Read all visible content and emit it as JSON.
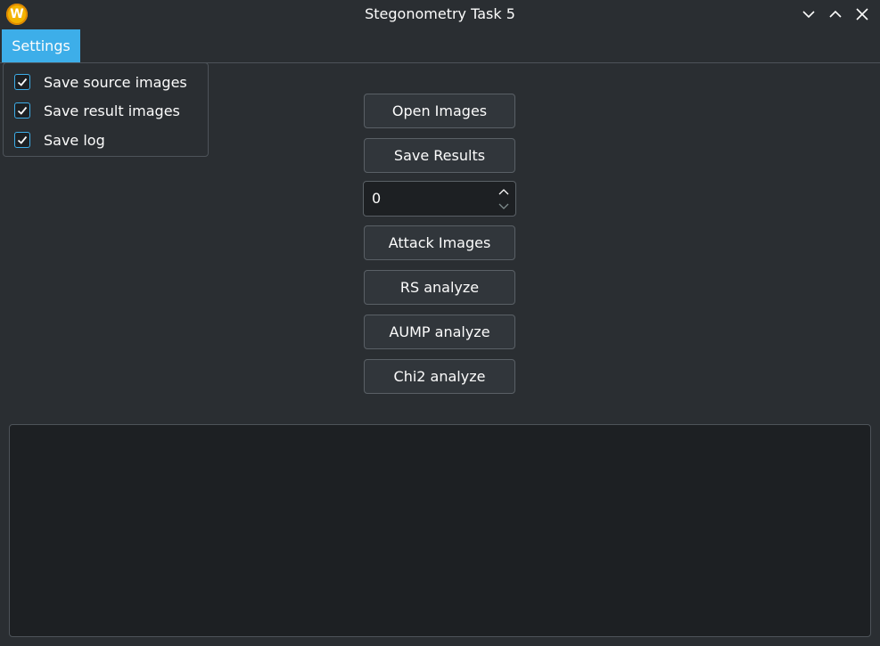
{
  "window": {
    "title": "Stegonometry Task 5",
    "logo_letter": "W"
  },
  "menubar": {
    "settings_label": "Settings"
  },
  "settings_menu": {
    "items": [
      {
        "label": "Save source images",
        "checked": true
      },
      {
        "label": "Save result images",
        "checked": true
      },
      {
        "label": "Save log",
        "checked": true
      }
    ]
  },
  "controls": {
    "open_images": "Open Images",
    "save_results": "Save Results",
    "spin_value": "0",
    "attack_images": "Attack Images",
    "rs_analyze": "RS analyze",
    "aump_analyze": "AUMP analyze",
    "chi2_analyze": "Chi2 analyze"
  },
  "log": {
    "text": ""
  },
  "colors": {
    "accent": "#3daee9",
    "background": "#2a2e32",
    "input_background": "#1d2023"
  },
  "icons": {
    "app": "app-logo-icon",
    "minimize": "chevron-down-icon",
    "maximize": "chevron-up-icon",
    "close": "close-icon",
    "check": "check-icon"
  }
}
